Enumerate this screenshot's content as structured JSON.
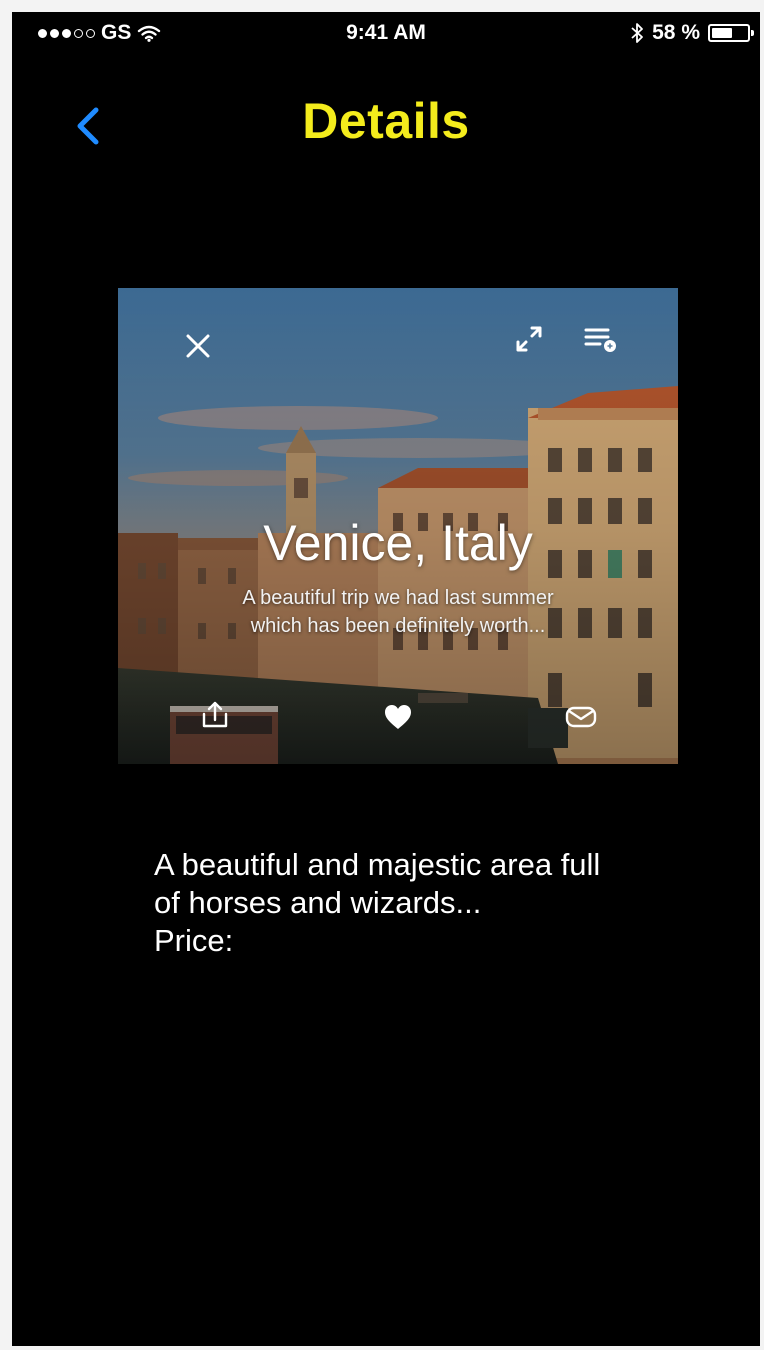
{
  "status_bar": {
    "carrier": "GS",
    "signal": "●●●○○",
    "time": "9:41 AM",
    "battery": "58 %",
    "battery_level": 0.58
  },
  "nav": {
    "title": "Details",
    "back_icon": "chevron-left-icon",
    "title_color": "#f4ec1c",
    "back_color": "#1f8bff"
  },
  "card": {
    "title": "Venice, Italy",
    "subtitle_line1": "A beautiful trip we had last summer",
    "subtitle_line2": "which has been definitely worth...",
    "icons": {
      "close": "close-icon",
      "expand": "expand-icon",
      "menu": "playlist-icon",
      "share": "share-icon",
      "like": "heart-icon",
      "mail": "mail-icon"
    }
  },
  "description": {
    "line1": "A beautiful and majestic area full",
    "line2": "of horses and wizards...",
    "price_label": "Price:"
  }
}
